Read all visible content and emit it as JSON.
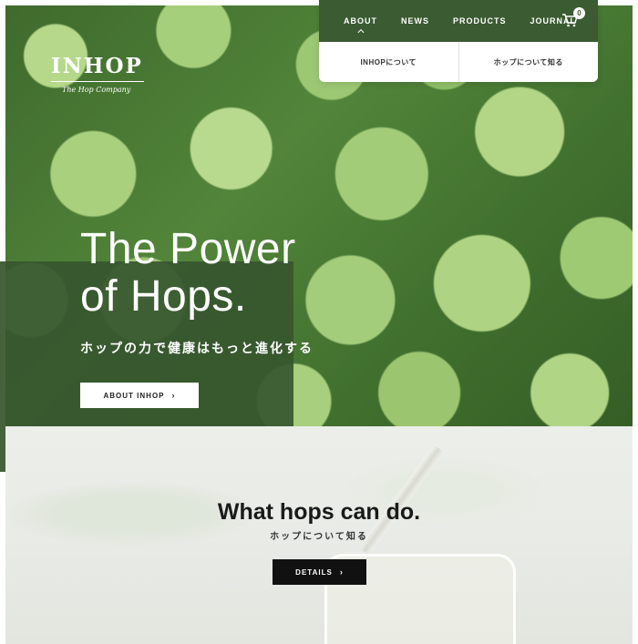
{
  "brand": {
    "name": "INHOP",
    "tagline": "The Hop Company"
  },
  "nav": {
    "items": [
      {
        "label": "ABOUT",
        "active": true
      },
      {
        "label": "NEWS",
        "active": false
      },
      {
        "label": "PRODUCTS",
        "active": false
      },
      {
        "label": "JOURNAL",
        "active": false
      }
    ],
    "cart_count": "0",
    "cart_icon": "cart-icon"
  },
  "subnav": {
    "items": [
      {
        "label": "INHOPについて"
      },
      {
        "label": "ホップについて知る"
      }
    ]
  },
  "hero": {
    "title_line1": "The Power",
    "title_line2": "of Hops.",
    "subtitle": "ホップの力で健康はもっと進化する",
    "button_label": "ABOUT INHOP",
    "button_arrow": "›"
  },
  "section": {
    "title": "What hops can do.",
    "subtitle": "ホップについて知る",
    "button_label": "DETAILS",
    "button_arrow": "›"
  },
  "colors": {
    "nav_green": "#3b5b32",
    "panel_green": "#37562e",
    "button_dark": "#111111"
  }
}
